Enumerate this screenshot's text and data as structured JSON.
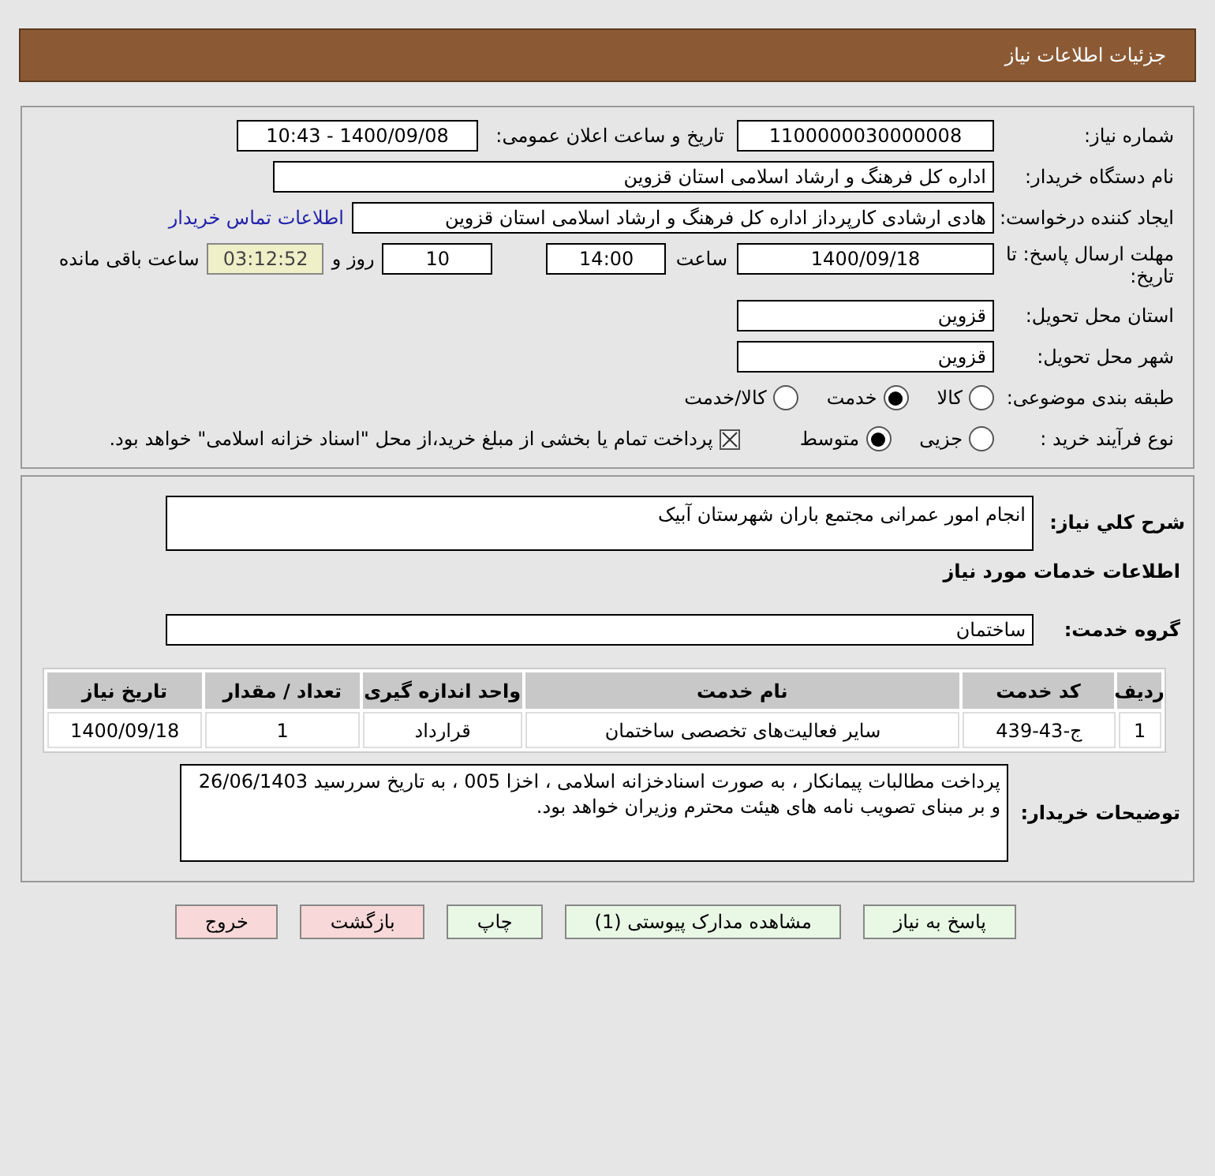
{
  "header": {
    "title": "جزئیات اطلاعات نیاز"
  },
  "details": {
    "need_number": {
      "label": "شماره نیاز:",
      "value": "1100000030000008"
    },
    "announce": {
      "label": "تاریخ و ساعت اعلان عمومی:",
      "value": "1400/09/08 - 10:43"
    },
    "buyer": {
      "label": "نام دستگاه خریدار:",
      "value": "اداره کل فرهنگ و ارشاد اسلامی استان قزوین"
    },
    "creator": {
      "label": "ایجاد کننده درخواست:",
      "value": "هادی ارشادی کارپرداز اداره کل فرهنگ و ارشاد اسلامی استان قزوین",
      "link": "اطلاعات تماس خریدار"
    },
    "deadline": {
      "label": "مهلت ارسال پاسخ: تا تاریخ:",
      "date": "1400/09/18",
      "time_label": "ساعت",
      "time": "14:00",
      "days": "10",
      "days_label": "روز و",
      "remaining": "03:12:52",
      "remaining_label": "ساعت باقی مانده"
    },
    "province": {
      "label": "استان محل تحویل:",
      "value": "قزوین"
    },
    "city": {
      "label": "شهر محل تحویل:",
      "value": "قزوین"
    },
    "category": {
      "label": "طبقه بندی موضوعی:",
      "options": [
        {
          "label": "کالا",
          "selected": false
        },
        {
          "label": "خدمت",
          "selected": true
        },
        {
          "label": "کالا/خدمت",
          "selected": false
        }
      ]
    },
    "process": {
      "label": "نوع فرآیند خرید :",
      "options": [
        {
          "label": "جزیی",
          "selected": false
        },
        {
          "label": "متوسط",
          "selected": true
        }
      ],
      "payment": {
        "checked": true,
        "label": "پرداخت تمام یا بخشی از مبلغ خرید،از محل \"اسناد خزانه اسلامی\" خواهد بود."
      }
    }
  },
  "summary": {
    "label": "شرح کلي نياز:",
    "value": "انجام امور عمرانی مجتمع باران شهرستان آبیک"
  },
  "services_title": "اطلاعات خدمات مورد نیاز",
  "service_group": {
    "label": "گروه خدمت:",
    "value": "ساختمان"
  },
  "table": {
    "columns": [
      "ردیف",
      "کد خدمت",
      "نام خدمت",
      "واحد اندازه گیری",
      "تعداد / مقدار",
      "تاریخ نیاز"
    ],
    "rows": [
      [
        "1",
        "ج-43-439",
        "سایر فعالیت‌های تخصصی ساختمان",
        "قرارداد",
        "1",
        "1400/09/18"
      ]
    ]
  },
  "buyer_notes": {
    "label": "توضیحات خریدار:",
    "value": "پرداخت مطالبات پیمانکار ، به صورت اسنادخزانه اسلامی ، اخزا 005 ، به تاریخ سررسید 26/06/1403 و بر مبنای تصویب نامه های هیئت محترم وزیران  خواهد بود."
  },
  "buttons": [
    {
      "label": "پاسخ به نیاز",
      "kind": "normal"
    },
    {
      "label": "مشاهده مدارک پیوستی (1)",
      "kind": "normal"
    },
    {
      "label": "چاپ",
      "kind": "normal"
    },
    {
      "label": "بازگشت",
      "kind": "danger"
    },
    {
      "label": "خروج",
      "kind": "danger"
    }
  ]
}
